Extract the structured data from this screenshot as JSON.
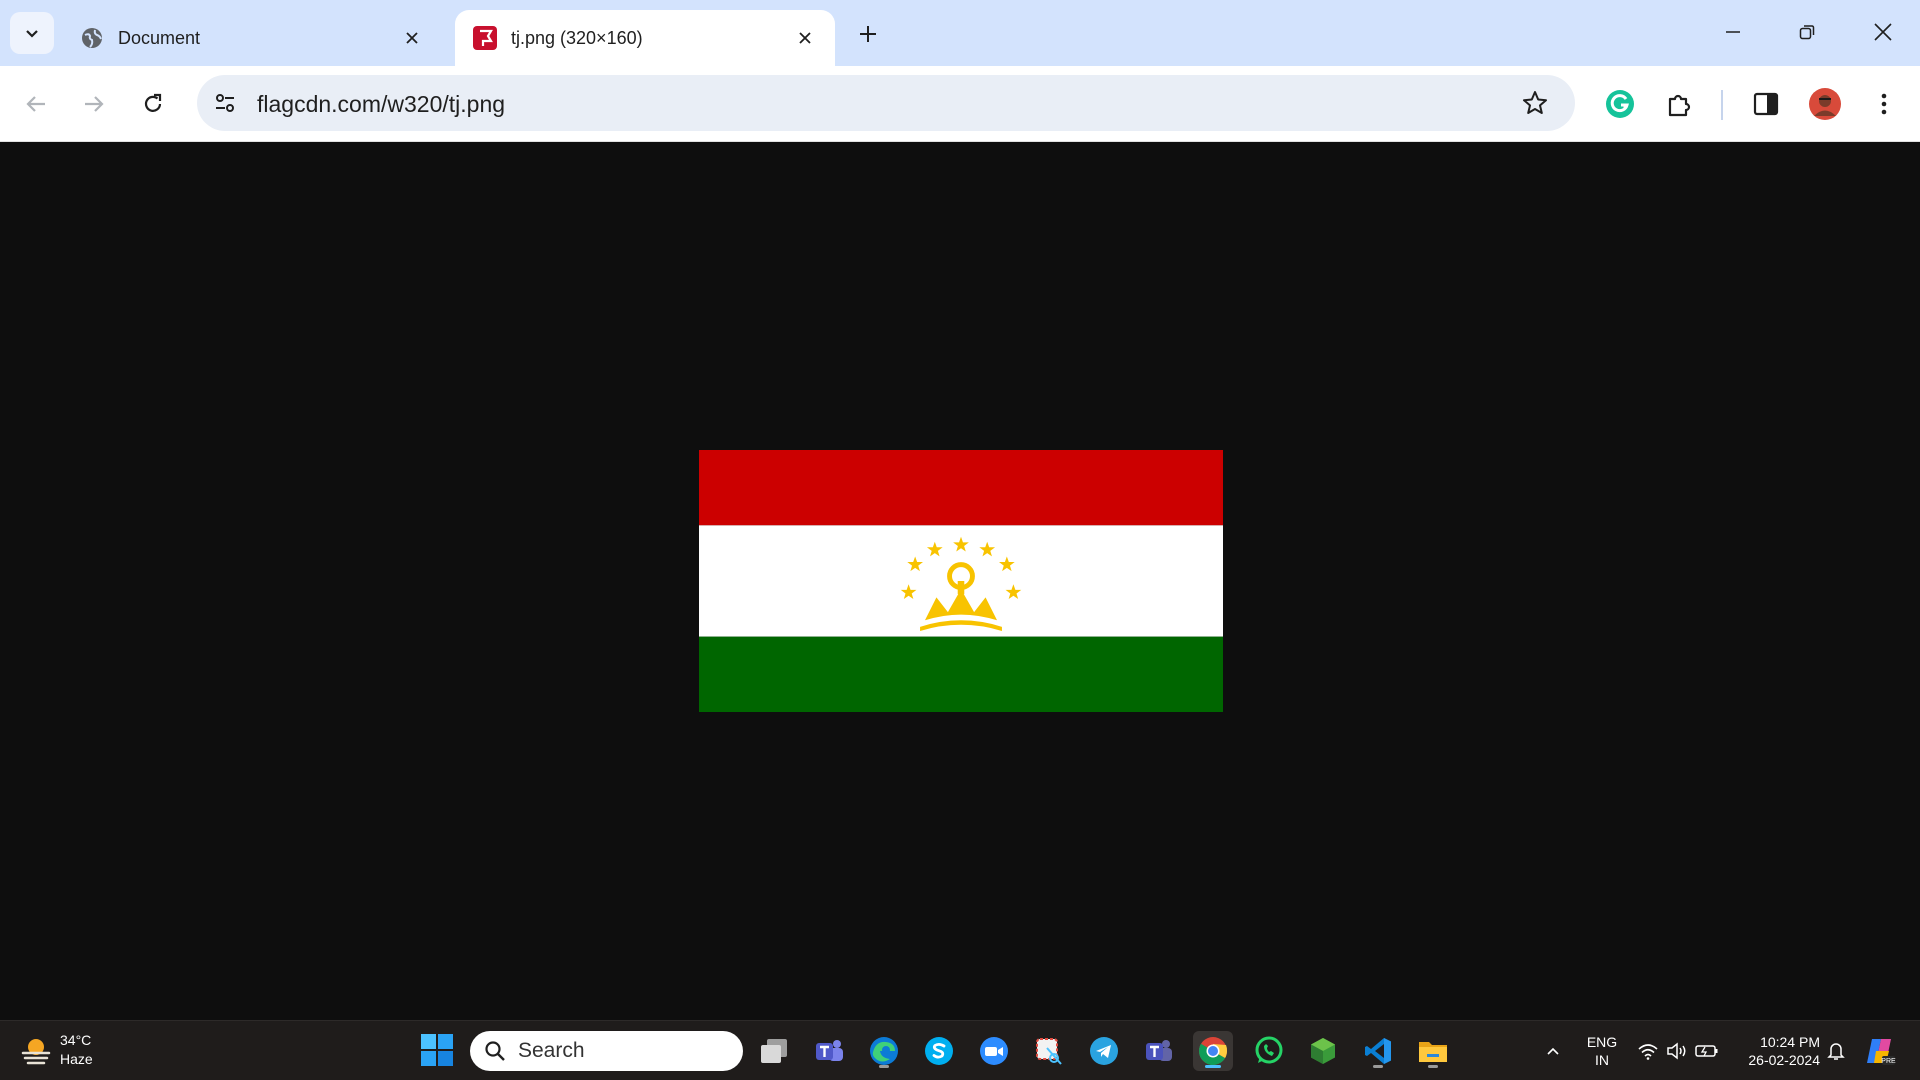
{
  "browser": {
    "tabs": [
      {
        "title": "Document",
        "active": false,
        "favicon": "globe-icon"
      },
      {
        "title": "tj.png (320×160)",
        "active": true,
        "favicon": "flagcdn-icon"
      }
    ],
    "url": "flagcdn.com/w320/tj.png",
    "colors": {
      "tabstrip": "#d3e3fd",
      "omnibox": "#e9eef6",
      "viewer_bg": "#0e0e0e"
    }
  },
  "image": {
    "alt": "tj.png",
    "colors": {
      "red": "#cc0000",
      "white": "#ffffff",
      "green": "#006600",
      "gold": "#f8c300"
    }
  },
  "taskbar": {
    "weather": {
      "temp": "34°C",
      "condition": "Haze"
    },
    "search_placeholder": "Search",
    "apps": [
      "task-view",
      "teams",
      "edge",
      "skype",
      "zoom",
      "snipping-tool",
      "telegram",
      "teams-classic",
      "chrome",
      "whatsapp",
      "app-cube",
      "vscode",
      "file-explorer"
    ],
    "lang_line1": "ENG",
    "lang_line2": "IN",
    "time": "10:24 PM",
    "date": "26-02-2024"
  }
}
